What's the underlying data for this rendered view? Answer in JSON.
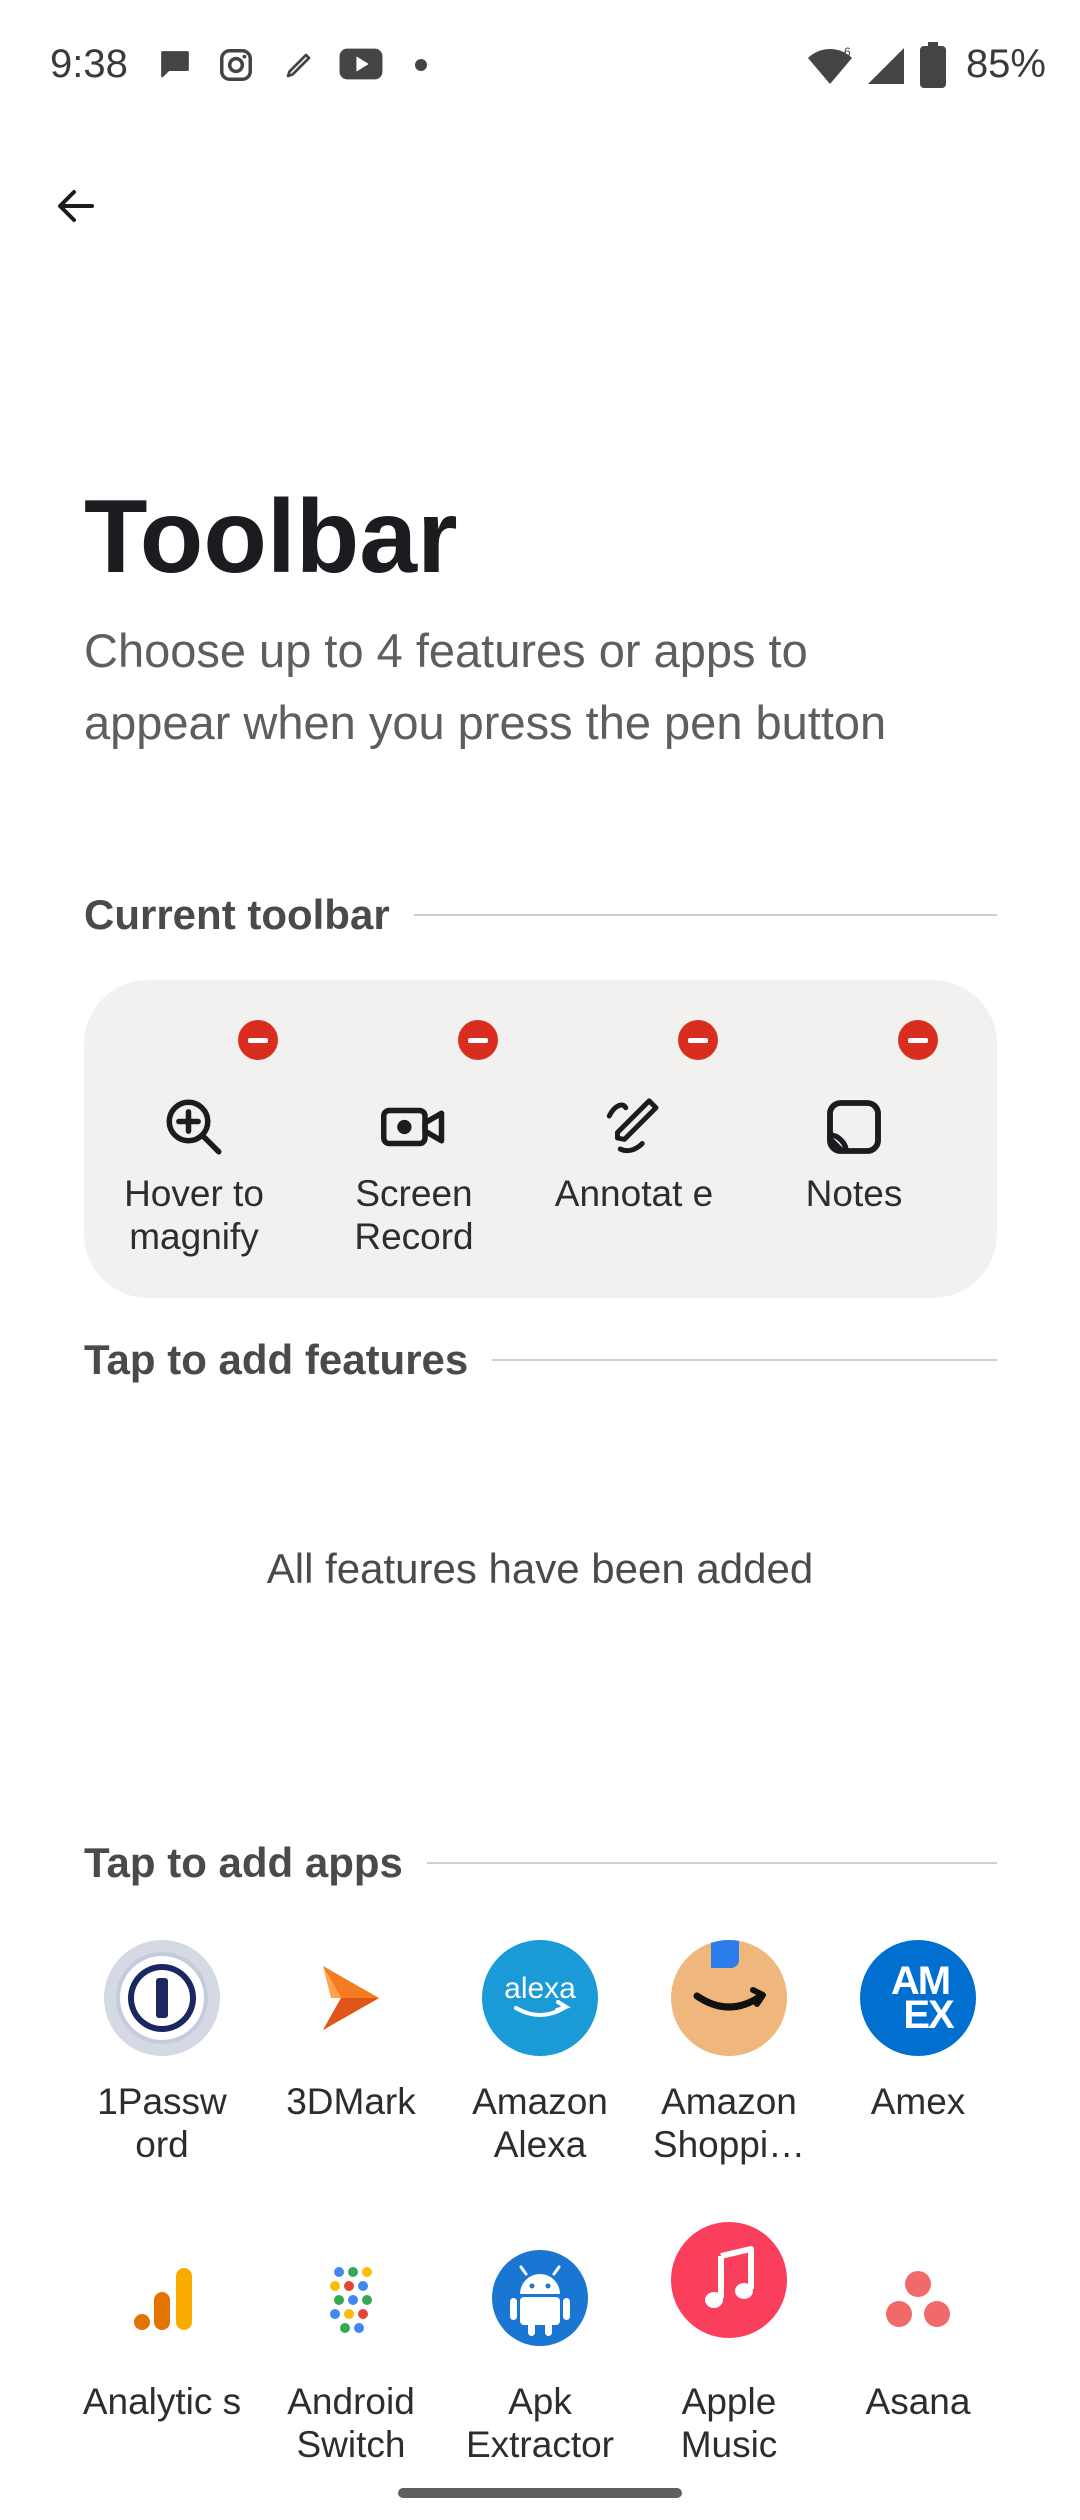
{
  "status_bar": {
    "time": "9:38",
    "notification_icons": [
      "messages-icon",
      "instagram-icon",
      "pen-icon",
      "youtube-icon",
      "dot-icon"
    ],
    "system_icons": [
      "wifi-icon",
      "signal-icon",
      "battery-icon"
    ],
    "battery": "85%"
  },
  "header": {
    "back_icon": "back-arrow-icon",
    "title": "Toolbar",
    "subtitle": "Choose up to 4 features or apps to appear when you press the pen button"
  },
  "current_toolbar": {
    "heading": "Current toolbar",
    "items": [
      {
        "label": "Hover to magnify",
        "icon": "zoom-in-icon"
      },
      {
        "label": "Screen Record",
        "icon": "video-camera-icon"
      },
      {
        "label": "Annotat e",
        "icon": "annotate-pen-icon"
      },
      {
        "label": "Notes",
        "icon": "notes-icon"
      }
    ]
  },
  "features": {
    "heading": "Tap to add features",
    "empty_message": "All features have been added"
  },
  "apps": {
    "heading": "Tap to add apps",
    "items": [
      {
        "label": "1Passw ord",
        "icon": "1password-icon"
      },
      {
        "label": "3DMark",
        "icon": "3dmark-icon"
      },
      {
        "label": "Amazon Alexa",
        "icon": "alexa-icon"
      },
      {
        "label": "Amazon Shoppi…",
        "icon": "amazon-shopping-icon"
      },
      {
        "label": "Amex",
        "icon": "amex-icon"
      },
      {
        "label": "Analytic s",
        "icon": "analytics-icon"
      },
      {
        "label": "Android Switch",
        "icon": "android-switch-icon"
      },
      {
        "label": "Apk Extractor",
        "icon": "apk-extractor-icon"
      },
      {
        "label": "Apple Music",
        "icon": "apple-music-icon"
      },
      {
        "label": "Asana",
        "icon": "asana-icon"
      }
    ],
    "alexa_text": "alexa",
    "amex_text": "AM EX"
  },
  "colors": {
    "remove_badge": "#d92d20",
    "card_bg": "#f3f1ef",
    "alexa_blue": "#1a9bd7",
    "amex_blue": "#016fd0",
    "apple_music_red": "#fa3f5c",
    "asana_coral": "#f06a6a"
  }
}
